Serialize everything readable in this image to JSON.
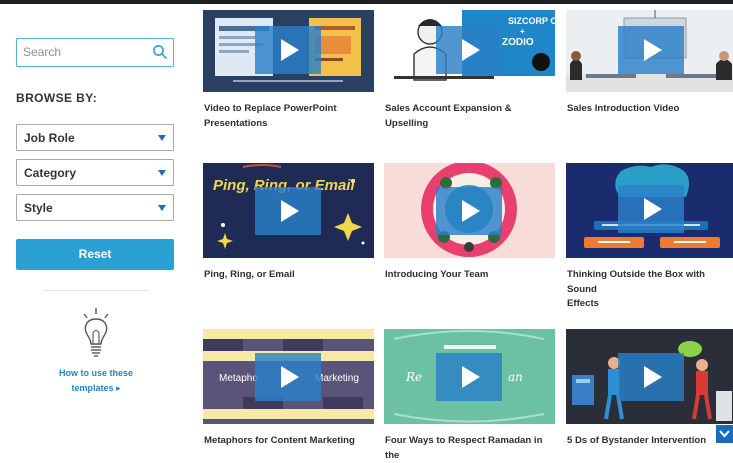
{
  "sidebar": {
    "search": {
      "placeholder": "Search",
      "icon": "search-icon"
    },
    "browse_label": "BROWSE BY:",
    "filters": [
      {
        "label": "Job Role"
      },
      {
        "label": "Category"
      },
      {
        "label": "Style"
      }
    ],
    "reset_label": "Reset",
    "howto": {
      "line1": "How to use these",
      "line2": "templates ▸"
    }
  },
  "thumb_text": {
    "zodio_corp_line1": "SIZCORP CO.",
    "zodio_corp_line2": "+",
    "zodio_corp_line3": "ZODIO",
    "ping_title": "Ping, Ring, or Email",
    "metaphor_left": "Metapho",
    "metaphor_right": "Marketing",
    "ramadan_left": "Re",
    "ramadan_right": "an"
  },
  "cards": [
    {
      "title_l1": "Video to Replace PowerPoint",
      "title_l2": "Presentations"
    },
    {
      "title_l1": "Sales Account Expansion & Upselling",
      "title_l2": ""
    },
    {
      "title_l1": "Sales Introduction Video",
      "title_l2": ""
    },
    {
      "title_l1": "Ping, Ring, or Email",
      "title_l2": ""
    },
    {
      "title_l1": "Introducing Your Team",
      "title_l2": ""
    },
    {
      "title_l1": "Thinking Outside the Box with Sound",
      "title_l2": "Effects"
    },
    {
      "title_l1": "Metaphors for Content Marketing",
      "title_l2": ""
    },
    {
      "title_l1": "Four Ways to Respect Ramadan in the",
      "title_l2": ""
    },
    {
      "title_l1": "5 Ds of Bystander Intervention",
      "title_l2": ""
    }
  ],
  "colors": {
    "accent": "#2aa0d4",
    "link": "#1e86c4",
    "play_overlay": "#2980c8",
    "caret": "#1f6fb2"
  }
}
